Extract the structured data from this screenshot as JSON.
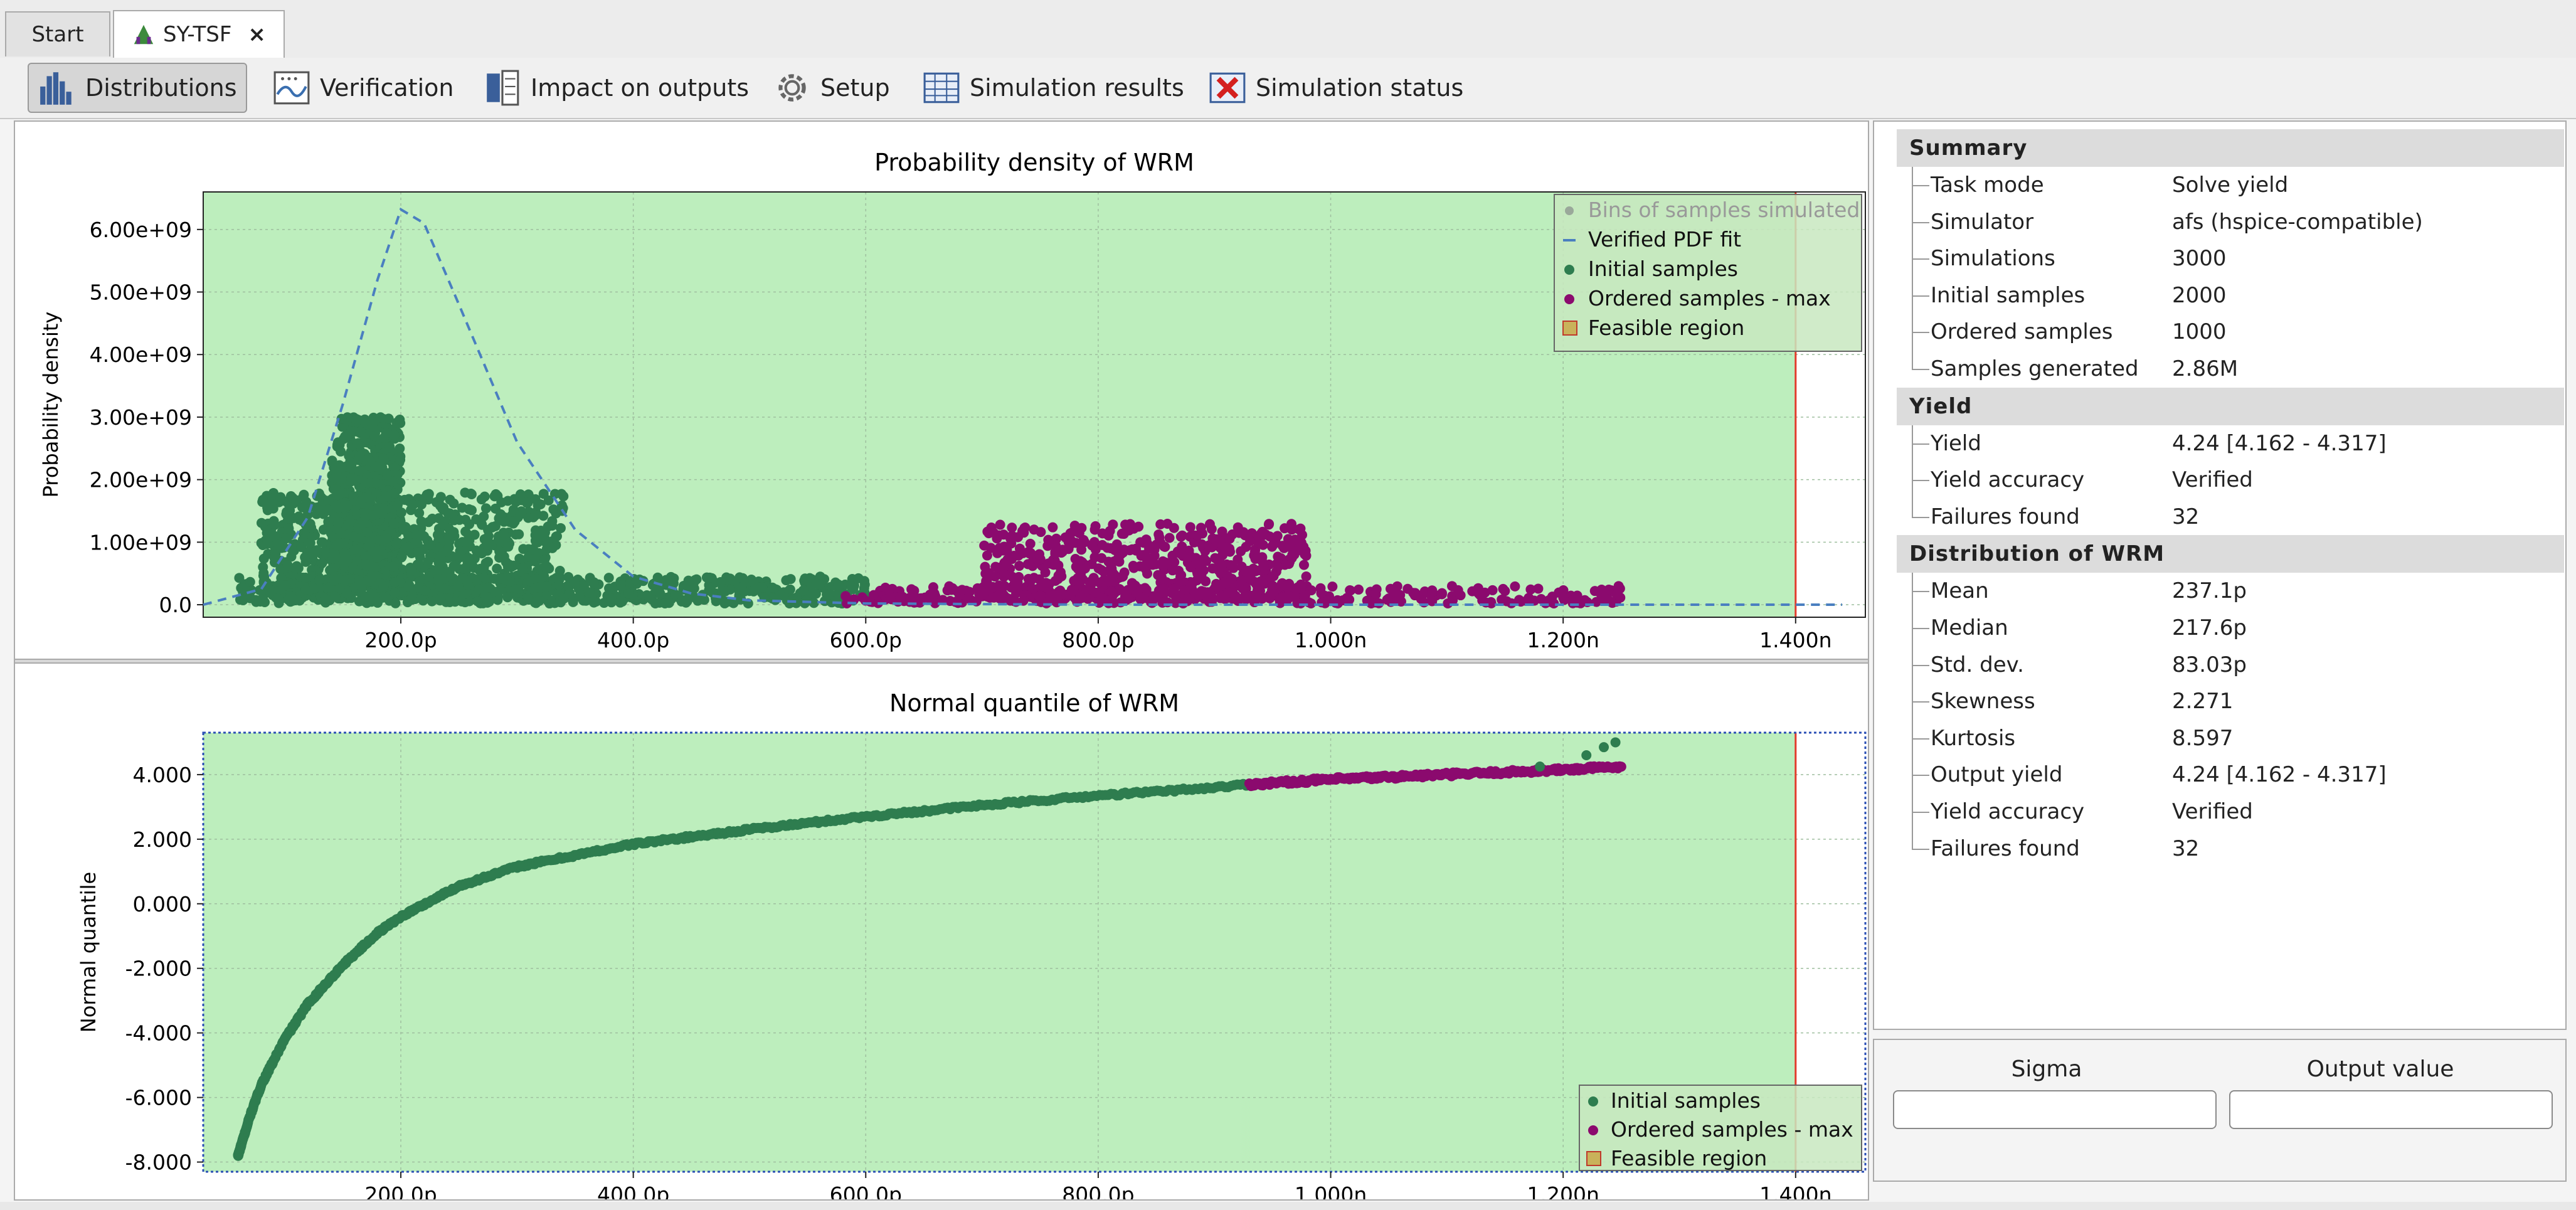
{
  "tabs": [
    {
      "label": "Start"
    },
    {
      "label": "SY-TSF",
      "close": "×"
    }
  ],
  "toolbar": [
    {
      "label": "Distributions",
      "icon": "histogram-icon"
    },
    {
      "label": "Verification",
      "icon": "verification-icon"
    },
    {
      "label": "Impact on outputs",
      "icon": "impact-icon"
    },
    {
      "label": "Setup",
      "icon": "gear-icon"
    },
    {
      "label": "Simulation results",
      "icon": "table-icon"
    },
    {
      "label": "Simulation status",
      "icon": "status-icon"
    }
  ],
  "summary": {
    "title": "Summary",
    "rows": [
      {
        "k": "Task mode",
        "v": "Solve yield"
      },
      {
        "k": "Simulator",
        "v": "afs (hspice-compatible)"
      },
      {
        "k": "Simulations",
        "v": "3000"
      },
      {
        "k": "Initial samples",
        "v": "2000"
      },
      {
        "k": "Ordered samples",
        "v": "1000"
      },
      {
        "k": "Samples generated",
        "v": "2.86M"
      }
    ]
  },
  "yield": {
    "title": "Yield",
    "rows": [
      {
        "k": "Yield",
        "v": "4.24 [4.162 - 4.317]"
      },
      {
        "k": "Yield accuracy",
        "v": "Verified"
      },
      {
        "k": "Failures found",
        "v": "32"
      }
    ]
  },
  "distribution": {
    "title": "Distribution of WRM",
    "rows": [
      {
        "k": "Mean",
        "v": "237.1p"
      },
      {
        "k": "Median",
        "v": "217.6p"
      },
      {
        "k": "Std. dev.",
        "v": "83.03p"
      },
      {
        "k": "Skewness",
        "v": "2.271"
      },
      {
        "k": "Kurtosis",
        "v": "8.597"
      },
      {
        "k": "Output yield",
        "v": "4.24 [4.162 - 4.317]"
      },
      {
        "k": "Yield accuracy",
        "v": "Verified"
      },
      {
        "k": "Failures found",
        "v": "32"
      }
    ]
  },
  "sigma_panel": {
    "sigma_label": "Sigma",
    "output_label": "Output value",
    "sigma_value": "",
    "output_value": ""
  },
  "colors": {
    "feasible": "#bdeebd",
    "initial": "#2e7d4f",
    "ordered": "#8b0a6e",
    "pdf": "#4a7fc0",
    "bound": "#e23b2c"
  },
  "chart_data": [
    {
      "type": "scatter",
      "title": "Probability density of WRM",
      "xlabel": "",
      "ylabel": "Probability density",
      "xlim": [
        0.03,
        1.46
      ],
      "ylim": [
        -0.2,
        6.6
      ],
      "x_unit": "n",
      "y_unit": "1e9",
      "xticks": [
        {
          "v": 0.2,
          "label": "200.0p"
        },
        {
          "v": 0.4,
          "label": "400.0p"
        },
        {
          "v": 0.6,
          "label": "600.0p"
        },
        {
          "v": 0.8,
          "label": "800.0p"
        },
        {
          "v": 1.0,
          "label": "1.000n"
        },
        {
          "v": 1.2,
          "label": "1.200n"
        },
        {
          "v": 1.4,
          "label": "1.400n"
        }
      ],
      "yticks": [
        {
          "v": 0,
          "label": "0.0"
        },
        {
          "v": 1,
          "label": "1.00e+09"
        },
        {
          "v": 2,
          "label": "2.00e+09"
        },
        {
          "v": 3,
          "label": "3.00e+09"
        },
        {
          "v": 4,
          "label": "4.00e+09"
        },
        {
          "v": 5,
          "label": "5.00e+09"
        },
        {
          "v": 6,
          "label": "6.00e+09"
        }
      ],
      "grid": true,
      "legend_position": "top-right",
      "legend": [
        {
          "label": "Bins of samples simulated",
          "kind": "bin"
        },
        {
          "label": "Verified PDF fit",
          "kind": "dash"
        },
        {
          "label": "Initial samples",
          "kind": "initial"
        },
        {
          "label": "Ordered samples - max",
          "kind": "ordered"
        },
        {
          "label": "Feasible region",
          "kind": "region"
        }
      ],
      "feasible_region": {
        "x_max": 1.4
      },
      "pdf_fit": {
        "x": [
          0.03,
          0.08,
          0.12,
          0.15,
          0.18,
          0.2,
          0.22,
          0.25,
          0.3,
          0.35,
          0.4,
          0.45,
          0.5,
          0.6,
          0.7,
          0.8,
          0.9,
          1.0,
          1.2,
          1.44
        ],
        "y": [
          0,
          0.25,
          1.4,
          3.2,
          5.2,
          6.32,
          6.1,
          4.8,
          2.6,
          1.2,
          0.45,
          0.18,
          0.07,
          0.02,
          0.01,
          0,
          0,
          0,
          0,
          0
        ]
      },
      "initial_samples": {
        "clusters": [
          {
            "x0": 0.14,
            "x1": 0.2,
            "y0": 0.3,
            "y1": 3.0,
            "n": 700
          },
          {
            "x0": 0.08,
            "x1": 0.34,
            "y0": 0.1,
            "y1": 1.8,
            "n": 900
          },
          {
            "x0": 0.06,
            "x1": 0.6,
            "y0": 0.02,
            "y1": 0.45,
            "n": 600
          }
        ]
      },
      "ordered_samples": {
        "clusters": [
          {
            "x0": 0.58,
            "x1": 1.25,
            "y0": 0.02,
            "y1": 0.3,
            "n": 350
          },
          {
            "x0": 0.7,
            "x1": 0.98,
            "y0": 0.1,
            "y1": 1.3,
            "n": 600
          }
        ]
      }
    },
    {
      "type": "scatter",
      "title": "Normal quantile of WRM",
      "xlabel": "",
      "ylabel": "Normal quantile",
      "xlim": [
        0.03,
        1.46
      ],
      "ylim": [
        -8.3,
        5.3
      ],
      "xticks": [
        {
          "v": 0.2,
          "label": "200.0p"
        },
        {
          "v": 0.4,
          "label": "400.0p"
        },
        {
          "v": 0.6,
          "label": "600.0p"
        },
        {
          "v": 0.8,
          "label": "800.0p"
        },
        {
          "v": 1.0,
          "label": "1.000n"
        },
        {
          "v": 1.2,
          "label": "1.200n"
        },
        {
          "v": 1.4,
          "label": "1.400n"
        }
      ],
      "yticks": [
        {
          "v": 4,
          "label": "4.000"
        },
        {
          "v": 2,
          "label": "2.000"
        },
        {
          "v": 0,
          "label": "0.000"
        },
        {
          "v": -2,
          "label": "-2.000"
        },
        {
          "v": -4,
          "label": "-4.000"
        },
        {
          "v": -6,
          "label": "-6.000"
        },
        {
          "v": -8,
          "label": "-8.000"
        }
      ],
      "grid": true,
      "legend_position": "bottom-right",
      "legend": [
        {
          "label": "Initial samples",
          "kind": "initial"
        },
        {
          "label": "Ordered samples - max",
          "kind": "ordered"
        },
        {
          "label": "Feasible region",
          "kind": "region"
        }
      ],
      "feasible_region": {
        "x_max": 1.4
      },
      "initial_curve": {
        "x": [
          0.06,
          0.07,
          0.08,
          0.1,
          0.12,
          0.15,
          0.18,
          0.2,
          0.25,
          0.3,
          0.4,
          0.5,
          0.6,
          0.7,
          0.8,
          0.9,
          0.93
        ],
        "y": [
          -7.8,
          -6.6,
          -5.6,
          -4.2,
          -3.1,
          -1.9,
          -0.9,
          -0.4,
          0.55,
          1.15,
          1.85,
          2.3,
          2.7,
          3.05,
          3.35,
          3.6,
          3.7
        ]
      },
      "ordered_curve": {
        "x": [
          0.93,
          1.0,
          1.1,
          1.2,
          1.25
        ],
        "y": [
          3.7,
          3.85,
          4.0,
          4.15,
          4.25
        ]
      },
      "tail_points": [
        {
          "x": 1.18,
          "y": 4.25
        },
        {
          "x": 1.22,
          "y": 4.6
        },
        {
          "x": 1.235,
          "y": 4.85
        },
        {
          "x": 1.245,
          "y": 5.0
        }
      ]
    }
  ]
}
